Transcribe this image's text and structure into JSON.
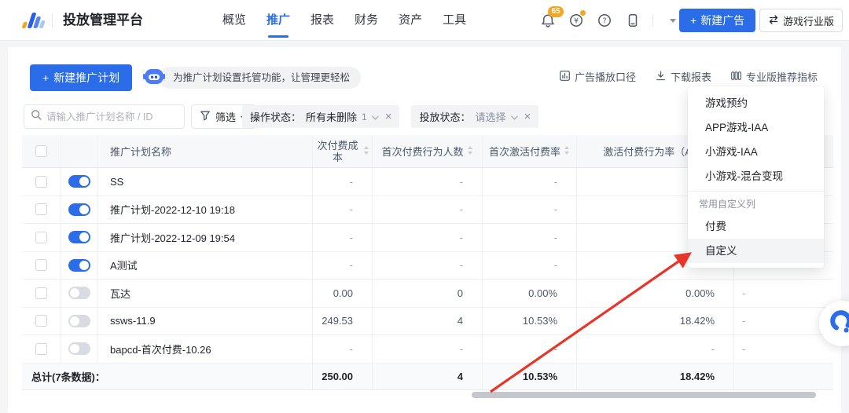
{
  "header": {
    "title": "投放管理平台",
    "nav": [
      {
        "label": "概览",
        "active": false
      },
      {
        "label": "推广",
        "active": true
      },
      {
        "label": "报表",
        "active": false
      },
      {
        "label": "财务",
        "active": false
      },
      {
        "label": "资产",
        "active": false
      },
      {
        "label": "工具",
        "active": false
      }
    ],
    "notification_count": "65",
    "new_ad_button": "新建广告",
    "industry_switch": "游戏行业版"
  },
  "toolbar": {
    "new_plan_button": "新建推广计划",
    "assistant_tip": "为推广计划设置托管功能，让管理更轻松",
    "links": [
      {
        "label": "广告播放口径",
        "icon": "chart-box-icon"
      },
      {
        "label": "下载报表",
        "icon": "download-icon"
      },
      {
        "label": "专业版推荐指标",
        "icon": "columns-icon"
      }
    ]
  },
  "filters": {
    "search_placeholder": "请输入推广计划名称 / ID",
    "filter_button": "筛选",
    "chips": [
      {
        "label": "操作状态：",
        "value": "所有未删除",
        "count": "1"
      },
      {
        "label": "投放状态：",
        "value": "请选择",
        "count": ""
      }
    ]
  },
  "table": {
    "headers": {
      "name": "推广计划名称",
      "cost": "次付费成本",
      "payers": "首次付费行为人数",
      "rate1": "首次激活付费率",
      "rate2": "激活付费行为率（AF"
    },
    "rows": [
      {
        "name": "SS",
        "enabled": true,
        "cost": "-",
        "payers": "-",
        "rate1": "-",
        "rate2": "-",
        "extra": "-"
      },
      {
        "name": "推广计划-2022-12-10 19:18",
        "enabled": true,
        "cost": "-",
        "payers": "-",
        "rate1": "-",
        "rate2": "-",
        "extra": "-"
      },
      {
        "name": "推广计划-2022-12-09 19:54",
        "enabled": true,
        "cost": "-",
        "payers": "-",
        "rate1": "-",
        "rate2": "-",
        "extra": "-"
      },
      {
        "name": "A测试",
        "enabled": true,
        "cost": "-",
        "payers": "-",
        "rate1": "-",
        "rate2": "-",
        "extra": "-"
      },
      {
        "name": "瓦达",
        "enabled": false,
        "cost": "0.00",
        "payers": "0",
        "rate1": "0.00%",
        "rate2": "0.00%",
        "extra": "-"
      },
      {
        "name": "ssws-11.9",
        "enabled": false,
        "cost": "249.53",
        "payers": "4",
        "rate1": "10.53%",
        "rate2": "18.42%",
        "extra": "-"
      },
      {
        "name": "bapcd-首次付费-10.26",
        "enabled": false,
        "cost": "-",
        "payers": "-",
        "rate1": "-",
        "rate2": "-",
        "extra": "-"
      }
    ],
    "footer": {
      "label": "总计(7条数据)：",
      "cost": "250.00",
      "payers": "4",
      "rate1": "10.53%",
      "rate2": "18.42%",
      "extra": ""
    }
  },
  "dropdown": {
    "presets": [
      "游戏预约",
      "APP游戏-IAA",
      "小游戏-IAA",
      "小游戏-混合变现"
    ],
    "section_label": "常用自定义列",
    "custom_items": [
      {
        "label": "付费",
        "highlighted": false
      },
      {
        "label": "自定义",
        "highlighted": true
      }
    ]
  },
  "icons": {
    "plus": "+",
    "close": "×"
  },
  "colors": {
    "accent": "#2b6de8",
    "badge_orange": "#f5a623",
    "arrow_red": "#e8352a",
    "toggle_off": "#d8dbe0"
  }
}
